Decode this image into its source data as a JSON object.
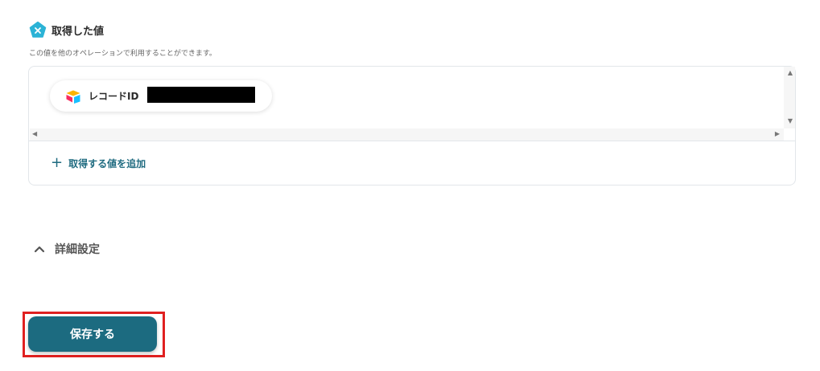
{
  "section": {
    "title": "取得した値",
    "description": "この値を他のオペレーションで利用することができます。",
    "icon": "yoom-pentagon-icon",
    "icon_color": "#2bb3d6"
  },
  "values": {
    "items": [
      {
        "label": "レコードID",
        "icon": "airtable-icon",
        "value": ""
      }
    ],
    "add_label": "取得する値を追加"
  },
  "advanced": {
    "label": "詳細設定",
    "expanded": true
  },
  "save": {
    "label": "保存する",
    "color": "#1c6b80",
    "highlight_color": "#e02020"
  }
}
